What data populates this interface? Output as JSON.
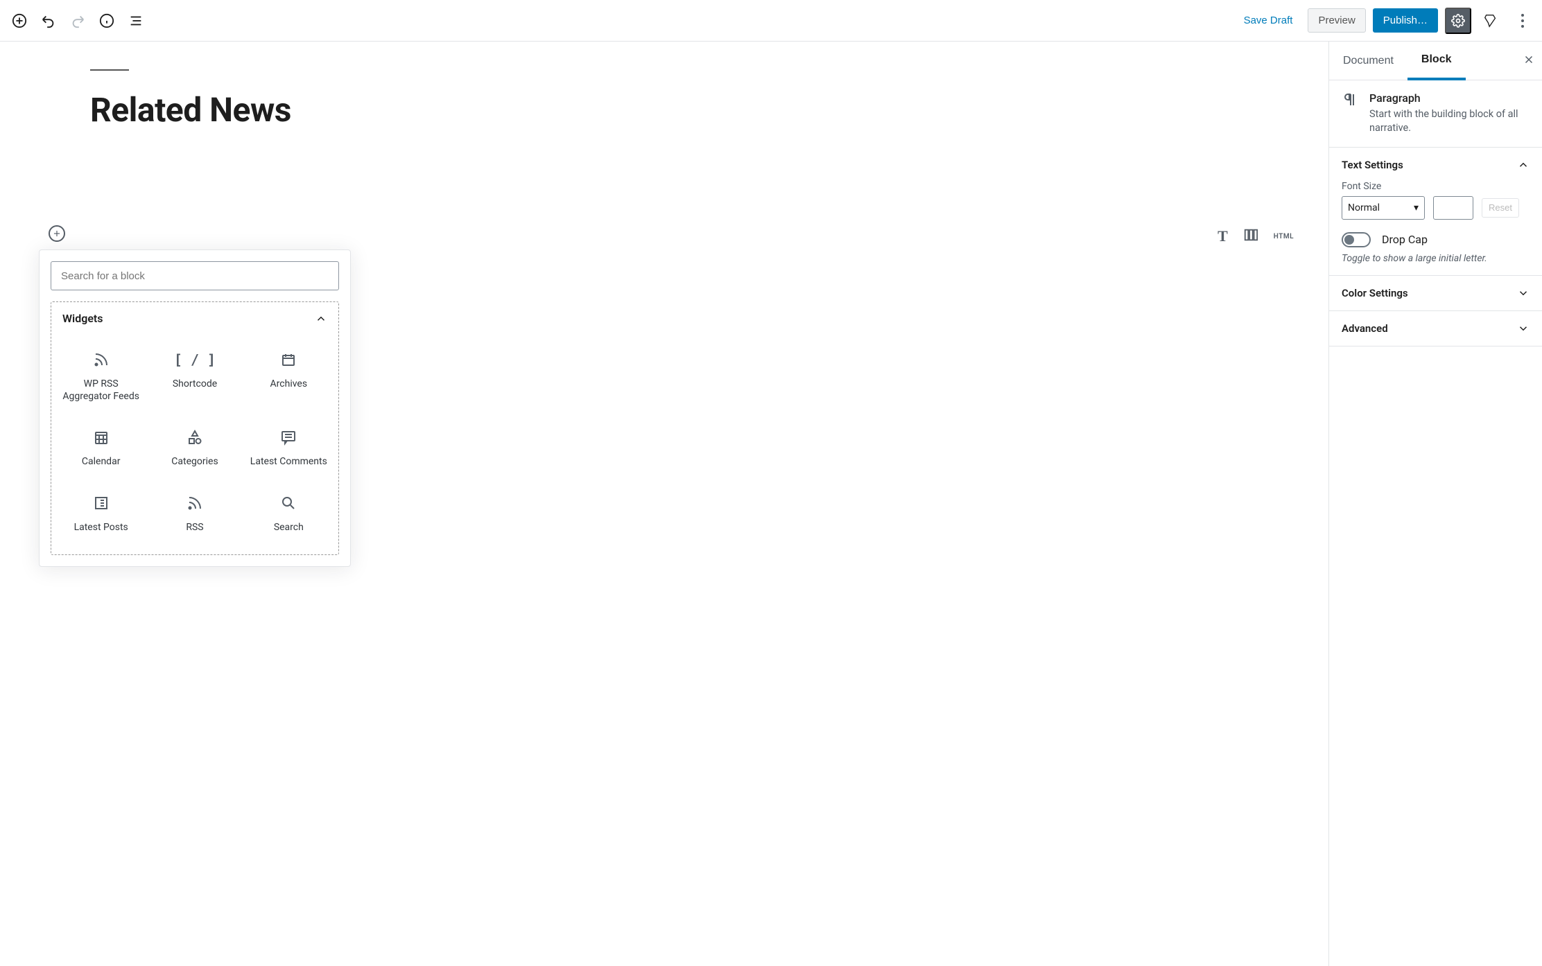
{
  "toolbar": {
    "save_draft": "Save Draft",
    "preview": "Preview",
    "publish": "Publish…"
  },
  "editor": {
    "title": "Related News"
  },
  "block_toolbar": {
    "html_label": "HTML"
  },
  "inserter": {
    "search_placeholder": "Search for a block",
    "category": "Widgets",
    "blocks": [
      {
        "label": "WP RSS Aggregator Feeds"
      },
      {
        "label": "Shortcode"
      },
      {
        "label": "Archives"
      },
      {
        "label": "Calendar"
      },
      {
        "label": "Categories"
      },
      {
        "label": "Latest Comments"
      },
      {
        "label": "Latest Posts"
      },
      {
        "label": "RSS"
      },
      {
        "label": "Search"
      }
    ]
  },
  "sidebar": {
    "tabs": {
      "document": "Document",
      "block": "Block"
    },
    "block_info": {
      "title": "Paragraph",
      "desc": "Start with the building block of all narrative."
    },
    "text_settings": {
      "title": "Text Settings",
      "font_size_label": "Font Size",
      "font_size_value": "Normal",
      "reset": "Reset",
      "drop_cap": "Drop Cap",
      "drop_cap_note": "Toggle to show a large initial letter."
    },
    "color_settings": {
      "title": "Color Settings"
    },
    "advanced": {
      "title": "Advanced"
    }
  }
}
